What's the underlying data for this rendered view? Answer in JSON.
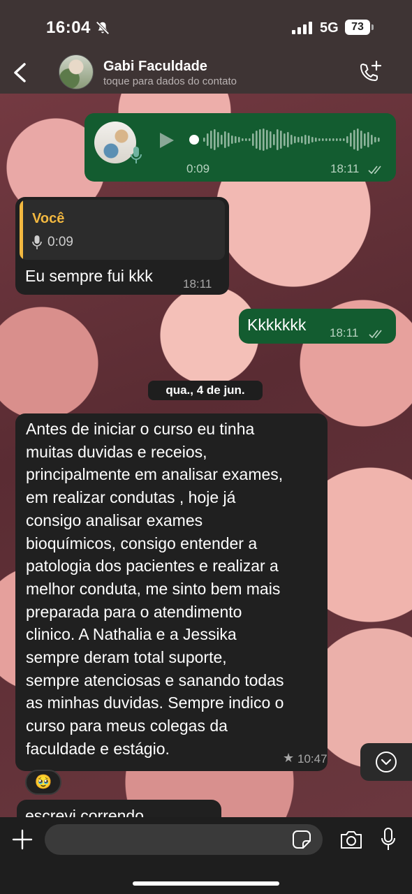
{
  "status_bar": {
    "time": "16:04",
    "network": "5G",
    "battery": "73"
  },
  "header": {
    "contact_name": "Gabi Faculdade",
    "subtitle": "toque para dados do contato"
  },
  "messages": {
    "voice": {
      "duration": "0:09",
      "time": "18:11"
    },
    "reply": {
      "quote_author": "Você",
      "quote_duration": "0:09",
      "text": "Eu sempre fui kkk",
      "time": "18:11"
    },
    "laugh": {
      "text": "Kkkkkkk",
      "time": "18:11"
    },
    "date_separator": "qua., 4 de jun.",
    "long": {
      "text": "Antes de iniciar o curso eu tinha\nmuitas duvidas e receios,\nprincipalmente  em analisar exames,\nem realizar condutas , hoje já\nconsigo analisar exames\nbioquímicos, consigo entender a\npatologia dos pacientes e realizar a\nmelhor conduta, me sinto bem mais\npreparada para o atendimento\nclinico. A Nathalia e a Jessika\nsempre deram total suporte,\nsempre atenciosas e sanando todas\nas minhas duvidas. Sempre indico o\ncurso para meus colegas da\nfaculdade e estágio.",
      "star": "★",
      "time": "10:47"
    },
    "reaction": "🥹",
    "partial": {
      "text": "escrevi correndo"
    }
  },
  "composer": {
    "placeholder": ""
  },
  "colors": {
    "outgoing_bubble": "#135c30",
    "incoming_bubble": "#202020",
    "quote_accent": "#f2b840",
    "header_bg": "#3e3434"
  },
  "icons": [
    "bell-slash-icon",
    "signal-icon",
    "back-icon",
    "add-call-icon",
    "play-icon",
    "mic-icon",
    "double-check-icon",
    "star-icon",
    "chevron-down-icon",
    "plus-icon",
    "sticker-icon",
    "camera-icon"
  ]
}
